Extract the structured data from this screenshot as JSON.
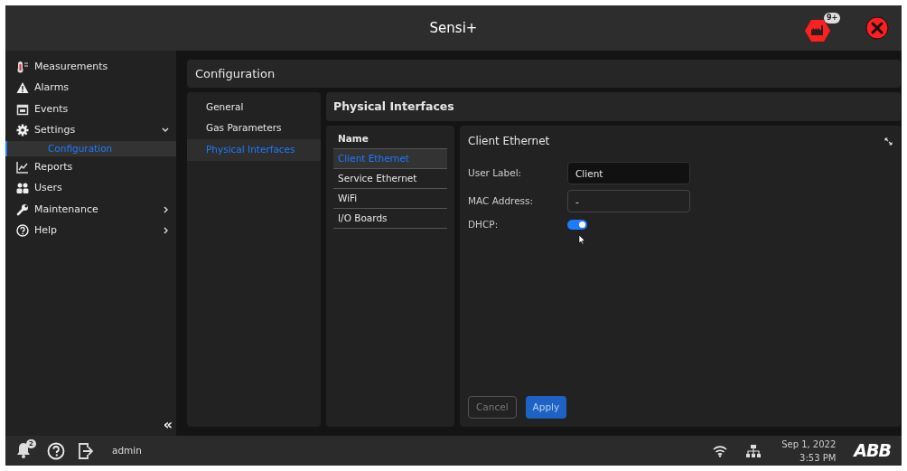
{
  "header": {
    "title": "Sensi+",
    "alarm_badge": "9+"
  },
  "sidebar": {
    "items": [
      {
        "label": "Measurements",
        "selected": false
      },
      {
        "label": "Alarms",
        "selected": false
      },
      {
        "label": "Events",
        "selected": false
      },
      {
        "label": "Settings",
        "selected": false,
        "expanded": true,
        "children": [
          {
            "label": "Configuration",
            "selected": true
          }
        ]
      },
      {
        "label": "Reports",
        "selected": false
      },
      {
        "label": "Users",
        "selected": false
      },
      {
        "label": "Maintenance",
        "selected": false,
        "expanded": false
      },
      {
        "label": "Help",
        "selected": false,
        "expanded": false
      }
    ],
    "collapse": "«"
  },
  "page_title": "Configuration",
  "sections": [
    {
      "label": "General",
      "selected": false
    },
    {
      "label": "Gas Parameters",
      "selected": false
    },
    {
      "label": "Physical Interfaces",
      "selected": true
    }
  ],
  "section_title": "Physical Interfaces",
  "interfaces": {
    "column": "Name",
    "rows": [
      {
        "label": "Client Ethernet",
        "selected": true
      },
      {
        "label": "Service Ethernet",
        "selected": false
      },
      {
        "label": "WiFi",
        "selected": false
      },
      {
        "label": "I/O Boards",
        "selected": false
      }
    ]
  },
  "detail": {
    "title": "Client Ethernet",
    "fields": [
      {
        "kind": "input",
        "label": "User Label:",
        "value": "Client",
        "disabled": false
      },
      {
        "kind": "input",
        "label": "MAC Address:",
        "value": "-",
        "disabled": true
      },
      {
        "kind": "toggle",
        "label": "DHCP:",
        "on": true
      }
    ],
    "buttons": [
      {
        "label": "Cancel",
        "disabled": true
      },
      {
        "label": "Apply",
        "disabled": false
      }
    ]
  },
  "footer": {
    "notification_count": "2",
    "user": "admin",
    "date": "Sep 1, 2022",
    "time": "3:53 PM",
    "logo": "ABB"
  }
}
